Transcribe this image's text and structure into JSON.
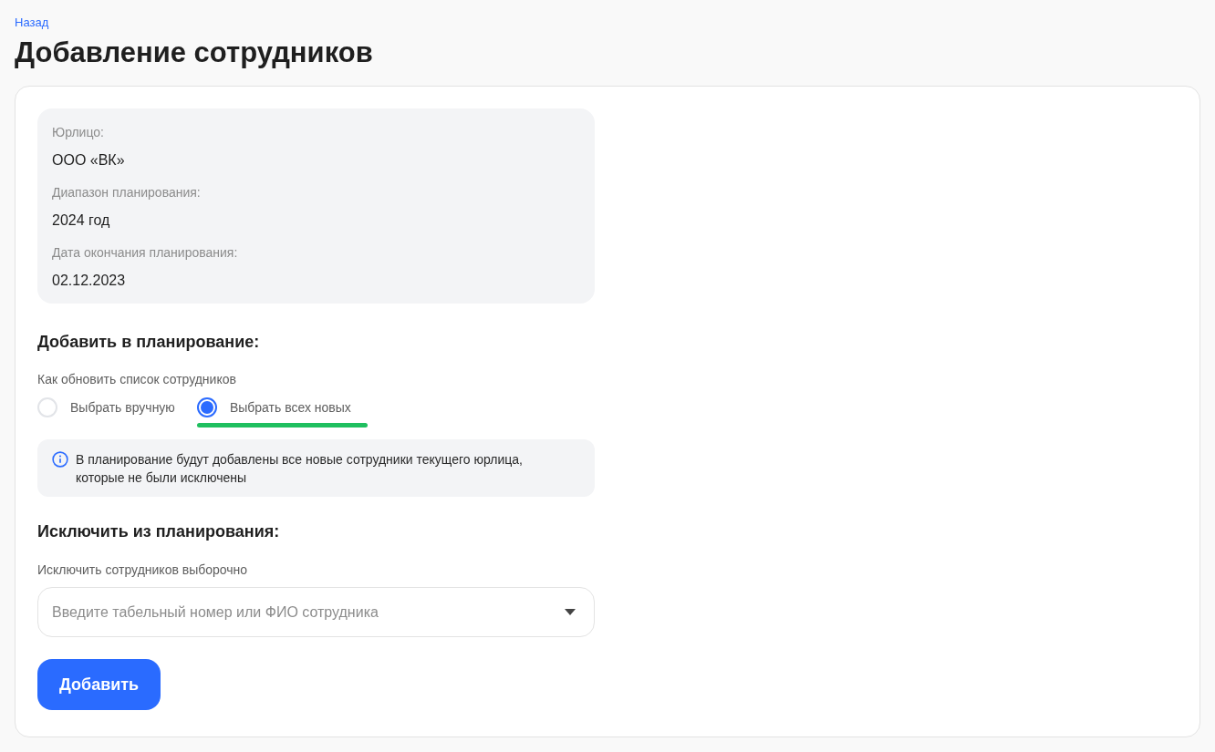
{
  "back_link": "Назад",
  "title": "Добавление сотрудников",
  "summary": [
    {
      "label": "Юрлицо:",
      "value": "ООО «ВК»"
    },
    {
      "label": "Диапазон планирования:",
      "value": "2024 год"
    },
    {
      "label": "Дата окончания планирования:",
      "value": "02.12.2023"
    }
  ],
  "add_section": {
    "heading": "Добавить в планирование:",
    "label": "Как обновить список сотрудников",
    "options": [
      {
        "label": "Выбрать вручную",
        "selected": false,
        "highlighted": false
      },
      {
        "label": "Выбрать всех новых",
        "selected": true,
        "highlighted": true
      }
    ],
    "note": "В планирование будут добавлены все новые сотрудники текущего юрлица, которые не были исключены"
  },
  "exclude_section": {
    "heading": "Исключить из планирования:",
    "label": "Исключить сотрудников выборочно",
    "select": {
      "placeholder": "Введите табельный номер или ФИО сотрудника"
    }
  },
  "submit_button": "Добавить"
}
